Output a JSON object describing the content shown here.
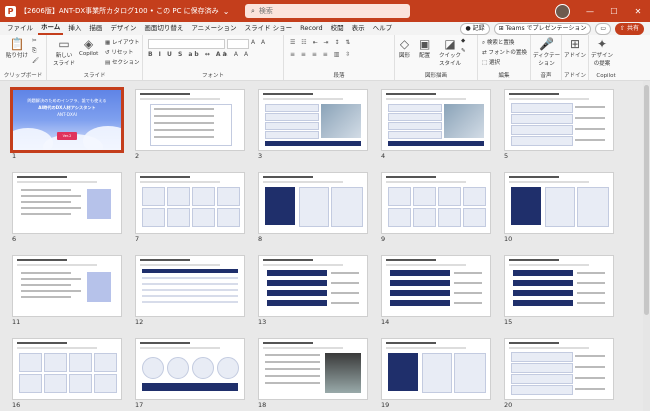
{
  "window": {
    "title": "【2606版】ANT-DX事業所カタログ100 • この PC に保存済み",
    "search_placeholder": "検索",
    "minimize": "—",
    "maximize": "☐",
    "close": "✕"
  },
  "menu": {
    "tabs": [
      "ファイル",
      "ホーム",
      "挿入",
      "描画",
      "デザイン",
      "画面切り替え",
      "アニメーション",
      "スライド ショー",
      "Record",
      "校閲",
      "表示",
      "ヘルプ"
    ],
    "active_tab": "ホーム",
    "record_label": "記録",
    "teams_label": "Teams でプレゼンテーション",
    "share_label": "共有"
  },
  "ribbon": {
    "clipboard": {
      "label": "クリップボード",
      "paste": "貼り付け"
    },
    "slides": {
      "label": "スライド",
      "new_slide": "新しい\nスライド",
      "reuse": "Copilot",
      "layout": "レイアウト",
      "reset": "リセット",
      "section": "セクション"
    },
    "font": {
      "label": "フォント"
    },
    "paragraph": {
      "label": "段落"
    },
    "drawing": {
      "label": "図形描画",
      "shapes": "図形",
      "arrange": "配置",
      "quick_styles": "クイック\nスタイル"
    },
    "editing": {
      "label": "編集",
      "find": "検索と置換",
      "replace": "フォントの置換",
      "select": "選択"
    },
    "voice": {
      "label": "音声",
      "dictate": "ディクテー\nション"
    },
    "addins": {
      "label": "アドイン",
      "addins": "アドイン"
    },
    "copilot": {
      "label": "Copilot",
      "designer": "デザイン\nの提案"
    }
  },
  "slides": [
    {
      "n": "1",
      "kind": "cover"
    },
    {
      "n": "2",
      "kind": "agenda"
    },
    {
      "n": "3",
      "kind": "photo"
    },
    {
      "n": "4",
      "kind": "photo"
    },
    {
      "n": "5",
      "kind": "list"
    },
    {
      "n": "6",
      "kind": "text"
    },
    {
      "n": "7",
      "kind": "grid"
    },
    {
      "n": "8",
      "kind": "diagram"
    },
    {
      "n": "9",
      "kind": "grid"
    },
    {
      "n": "10",
      "kind": "diagram"
    },
    {
      "n": "11",
      "kind": "text"
    },
    {
      "n": "12",
      "kind": "table"
    },
    {
      "n": "13",
      "kind": "flow"
    },
    {
      "n": "14",
      "kind": "flow"
    },
    {
      "n": "15",
      "kind": "flow"
    },
    {
      "n": "16",
      "kind": "grid"
    },
    {
      "n": "17",
      "kind": "circles"
    },
    {
      "n": "18",
      "kind": "person"
    },
    {
      "n": "19",
      "kind": "diagram"
    },
    {
      "n": "20",
      "kind": "list"
    }
  ],
  "cover_text": {
    "line1": "問題解決のためのインフラ、誰でも使える",
    "line2": "AI時代のDX人材アシスタント",
    "line3": "ANT-DXAI",
    "badge": "Ver.2"
  }
}
